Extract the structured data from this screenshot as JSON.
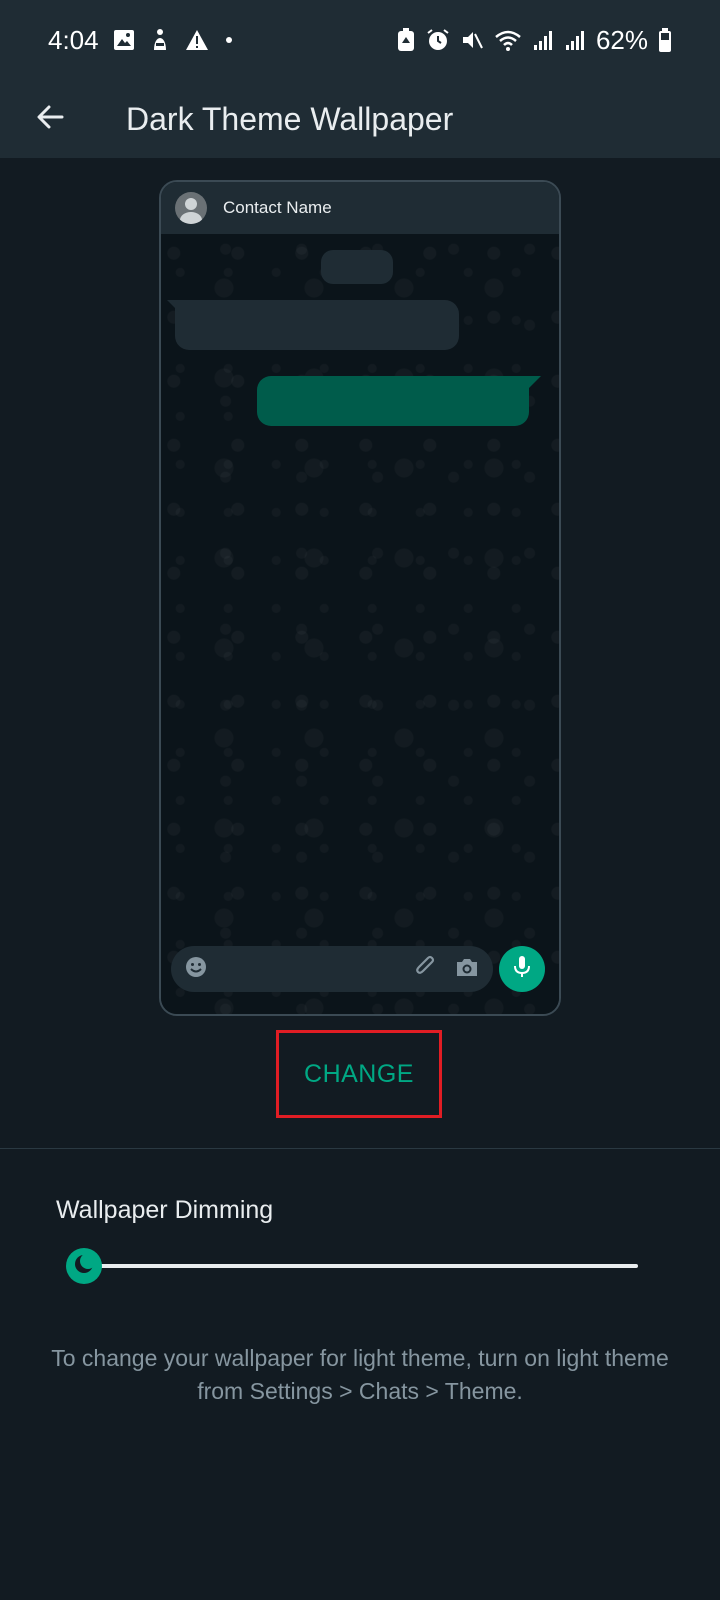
{
  "status_bar": {
    "time": "4:04",
    "battery": "62%",
    "left_icons": [
      "gallery-icon",
      "accessibility-icon",
      "warning-icon",
      "dot-icon"
    ],
    "right_icons": [
      "battery-saver-icon",
      "alarm-icon",
      "mute-icon",
      "wifi-icon",
      "signal-icon",
      "signal-icon",
      "battery-icon"
    ]
  },
  "app_bar": {
    "title": "Dark Theme Wallpaper"
  },
  "preview": {
    "contact_name": "Contact Name",
    "incoming_color": "#1f2c34",
    "outgoing_color": "#005c4b"
  },
  "change_button": {
    "label": "CHANGE"
  },
  "dimming": {
    "label": "Wallpaper Dimming",
    "value_fraction": 0.0
  },
  "hint_text": "To change your wallpaper for light theme, turn on light theme from Settings > Chats > Theme.",
  "colors": {
    "accent": "#00a884",
    "highlight_border": "#e11d24",
    "background": "#121b22",
    "bar": "#1f2c34"
  }
}
